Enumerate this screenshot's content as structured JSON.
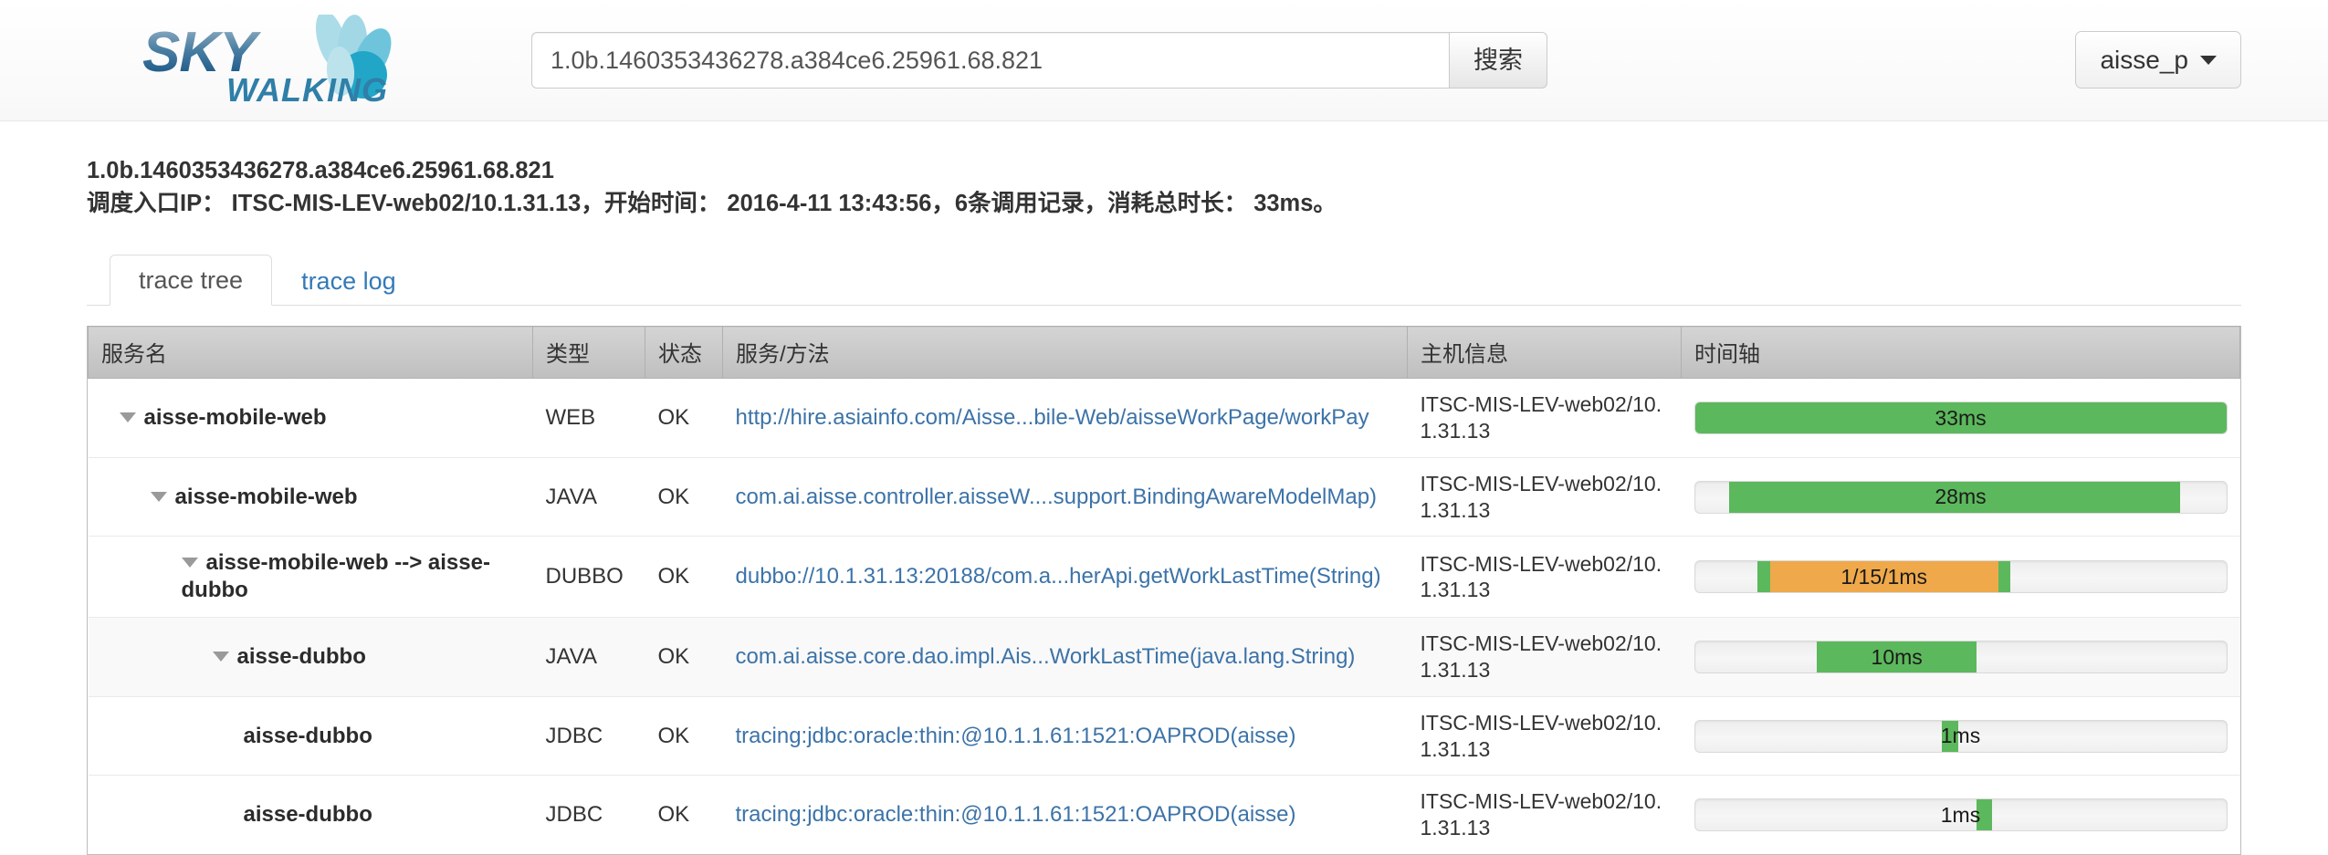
{
  "header": {
    "logo_primary": "SKY",
    "logo_secondary": "WALKING",
    "search": {
      "value": "1.0b.1460353436278.a384ce6.25961.68.821",
      "placeholder": "",
      "button_label": "搜索"
    },
    "user": {
      "label": "aisse_p",
      "caret_icon": "chevron-down-icon"
    }
  },
  "trace": {
    "id": "1.0b.1460353436278.a384ce6.25961.68.821",
    "summary": "调度入口IP： ITSC-MIS-LEV-web02/10.1.31.13，开始时间： 2016-4-11 13:43:56，6条调用记录，消耗总时长： 33ms。",
    "entry_ip": "ITSC-MIS-LEV-web02/10.1.31.13",
    "start_time": "2016-4-11 13:43:56",
    "span_count": "6",
    "total_duration": "33ms"
  },
  "tabs": [
    {
      "label": "trace tree",
      "active": true
    },
    {
      "label": "trace log",
      "active": false
    }
  ],
  "table": {
    "columns": [
      "服务名",
      "类型",
      "状态",
      "服务/方法",
      "主机信息",
      "时间轴"
    ],
    "rows": [
      {
        "name": "aisse-mobile-web",
        "depth": 0,
        "has_children": true,
        "type": "WEB",
        "status": "OK",
        "method": "http://hire.asiainfo.com/Aisse...bile-Web/aisseWorkPage/workPay",
        "host": "ITSC-MIS-LEV-web02/10.1.31.13",
        "timeline": {
          "label": "33ms",
          "label_align": "center",
          "segments": [
            {
              "color": "#5cb85c",
              "left_pct": 0,
              "width_pct": 100
            }
          ]
        }
      },
      {
        "name": "aisse-mobile-web",
        "depth": 1,
        "has_children": true,
        "type": "JAVA",
        "status": "OK",
        "method": "com.ai.aisse.controller.aisseW....support.BindingAwareModelMap)",
        "host": "ITSC-MIS-LEV-web02/10.1.31.13",
        "timeline": {
          "label": "28ms",
          "label_align": "center",
          "segments": [
            {
              "color": "#5cb85c",
              "left_pct": 6.5,
              "width_pct": 84.8
            }
          ]
        }
      },
      {
        "name": "aisse-mobile-web --> aisse-dubbo",
        "depth": 2,
        "has_children": true,
        "type": "DUBBO",
        "status": "OK",
        "method": "dubbo://10.1.31.13:20188/com.a...herApi.getWorkLastTime(String)",
        "host": "ITSC-MIS-LEV-web02/10.1.31.13",
        "timeline": {
          "label": "1/15/1ms",
          "label_align": "center-left",
          "segments": [
            {
              "color": "#5cb85c",
              "left_pct": 11.8,
              "width_pct": 2.3
            },
            {
              "color": "#efa94a",
              "left_pct": 14.1,
              "width_pct": 43.0
            },
            {
              "color": "#5cb85c",
              "left_pct": 57.1,
              "width_pct": 2.3
            }
          ]
        }
      },
      {
        "name": "aisse-dubbo",
        "depth": 3,
        "has_children": true,
        "type": "JAVA",
        "status": "OK",
        "method": "com.ai.aisse.core.dao.impl.Ais...WorkLastTime(java.lang.String)",
        "host": "ITSC-MIS-LEV-web02/10.1.31.13",
        "striped": true,
        "timeline": {
          "label": "10ms",
          "label_align": "center-left",
          "segments": [
            {
              "color": "#5cb85c",
              "left_pct": 23.0,
              "width_pct": 30.0
            }
          ]
        }
      },
      {
        "name": "aisse-dubbo",
        "depth": 4,
        "has_children": false,
        "type": "JDBC",
        "status": "OK",
        "method": "tracing:jdbc:oracle:thin:@10.1.1.61:1521:OAPROD(aisse)",
        "host": "ITSC-MIS-LEV-web02/10.1.31.13",
        "timeline": {
          "label": "1ms",
          "label_align": "center",
          "segments": [
            {
              "color": "#5cb85c",
              "left_pct": 46.5,
              "width_pct": 3.0
            }
          ]
        }
      },
      {
        "name": "aisse-dubbo",
        "depth": 4,
        "has_children": false,
        "type": "JDBC",
        "status": "OK",
        "method": "tracing:jdbc:oracle:thin:@10.1.1.61:1521:OAPROD(aisse)",
        "host": "ITSC-MIS-LEV-web02/10.1.31.13",
        "timeline": {
          "label": "1ms",
          "label_align": "center",
          "segments": [
            {
              "color": "#5cb85c",
              "left_pct": 53.0,
              "width_pct": 3.0
            }
          ]
        }
      }
    ]
  },
  "colors": {
    "bar_ok": "#5cb85c",
    "bar_warn": "#efa94a",
    "link": "#3c73a8",
    "logo_blue": "#1b6ca8",
    "logo_teal": "#19a0c4"
  }
}
